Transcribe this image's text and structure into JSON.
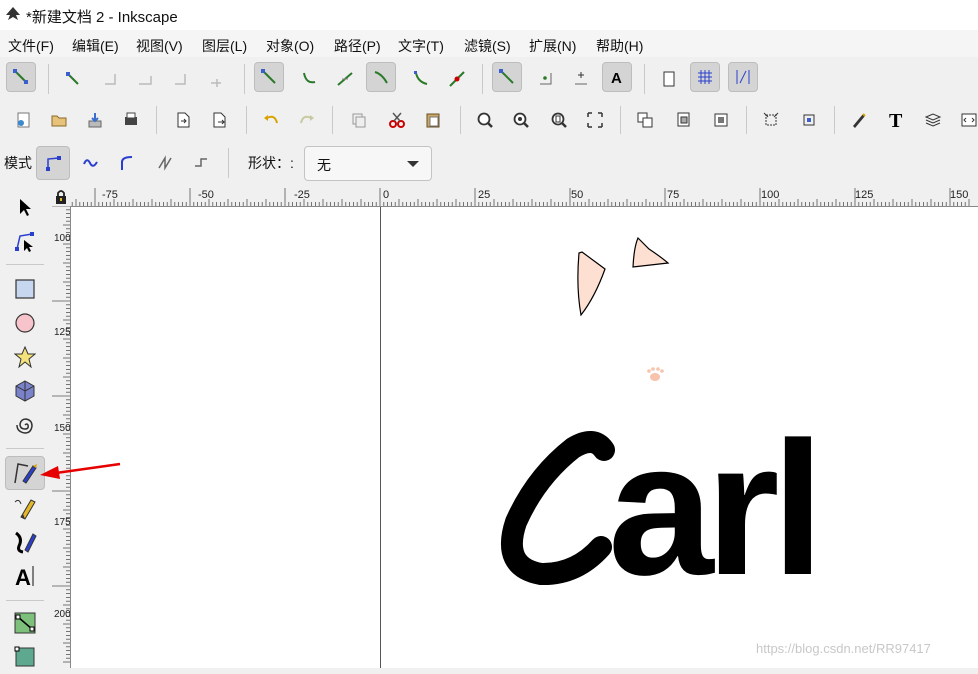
{
  "window": {
    "title": "*新建文档 2 - Inkscape"
  },
  "menu": [
    "文件(F)",
    "编辑(E)",
    "视图(V)",
    "图层(L)",
    "对象(O)",
    "路径(P)",
    "文字(T)",
    "滤镜(S)",
    "扩展(N)",
    "帮助(H)"
  ],
  "mode_bar": {
    "mode_label": "模式",
    "shape_label": "形状：:",
    "shape_value": "无"
  },
  "rulers": {
    "horizontal": [
      "-75",
      "-50",
      "-25",
      "0",
      "25",
      "50",
      "75",
      "100",
      "125",
      "150"
    ],
    "vertical": [
      "100",
      "125",
      "150",
      "175",
      "200"
    ]
  },
  "canvas": {
    "text": "arl",
    "big_letter": "C"
  },
  "watermark": "https://blog.csdn.net/RR97417",
  "colors": {
    "accent": "#e60000",
    "ear_fill": "#fde0d1",
    "paw": "#f6c3ac"
  },
  "icons": {
    "snap_toolbar": [
      "snap-toggle-icon",
      "snap-bbox-icon",
      "snap-bbox-edge-icon",
      "snap-bbox-corner-icon",
      "snap-bbox-midpoint-icon",
      "snap-bbox-center-icon",
      "snap-nodes-icon",
      "snap-path-icon",
      "snap-path-intersection-icon",
      "snap-cusp-node-icon",
      "snap-smooth-node-icon",
      "snap-line-midpoint-icon",
      "snap-others-icon",
      "snap-object-center-icon",
      "snap-rotation-center-icon",
      "snap-text-baseline-icon",
      "snap-page-border-icon",
      "snap-grid-icon",
      "snap-guide-icon"
    ],
    "tools": [
      "selector-icon",
      "node-editor-icon",
      "rectangle-icon",
      "circle-icon",
      "star-icon",
      "box3d-icon",
      "spiral-icon",
      "bezier-pen-icon",
      "pencil-icon",
      "calligraphy-icon",
      "text-icon",
      "gradient-icon",
      "mesh-icon"
    ]
  }
}
